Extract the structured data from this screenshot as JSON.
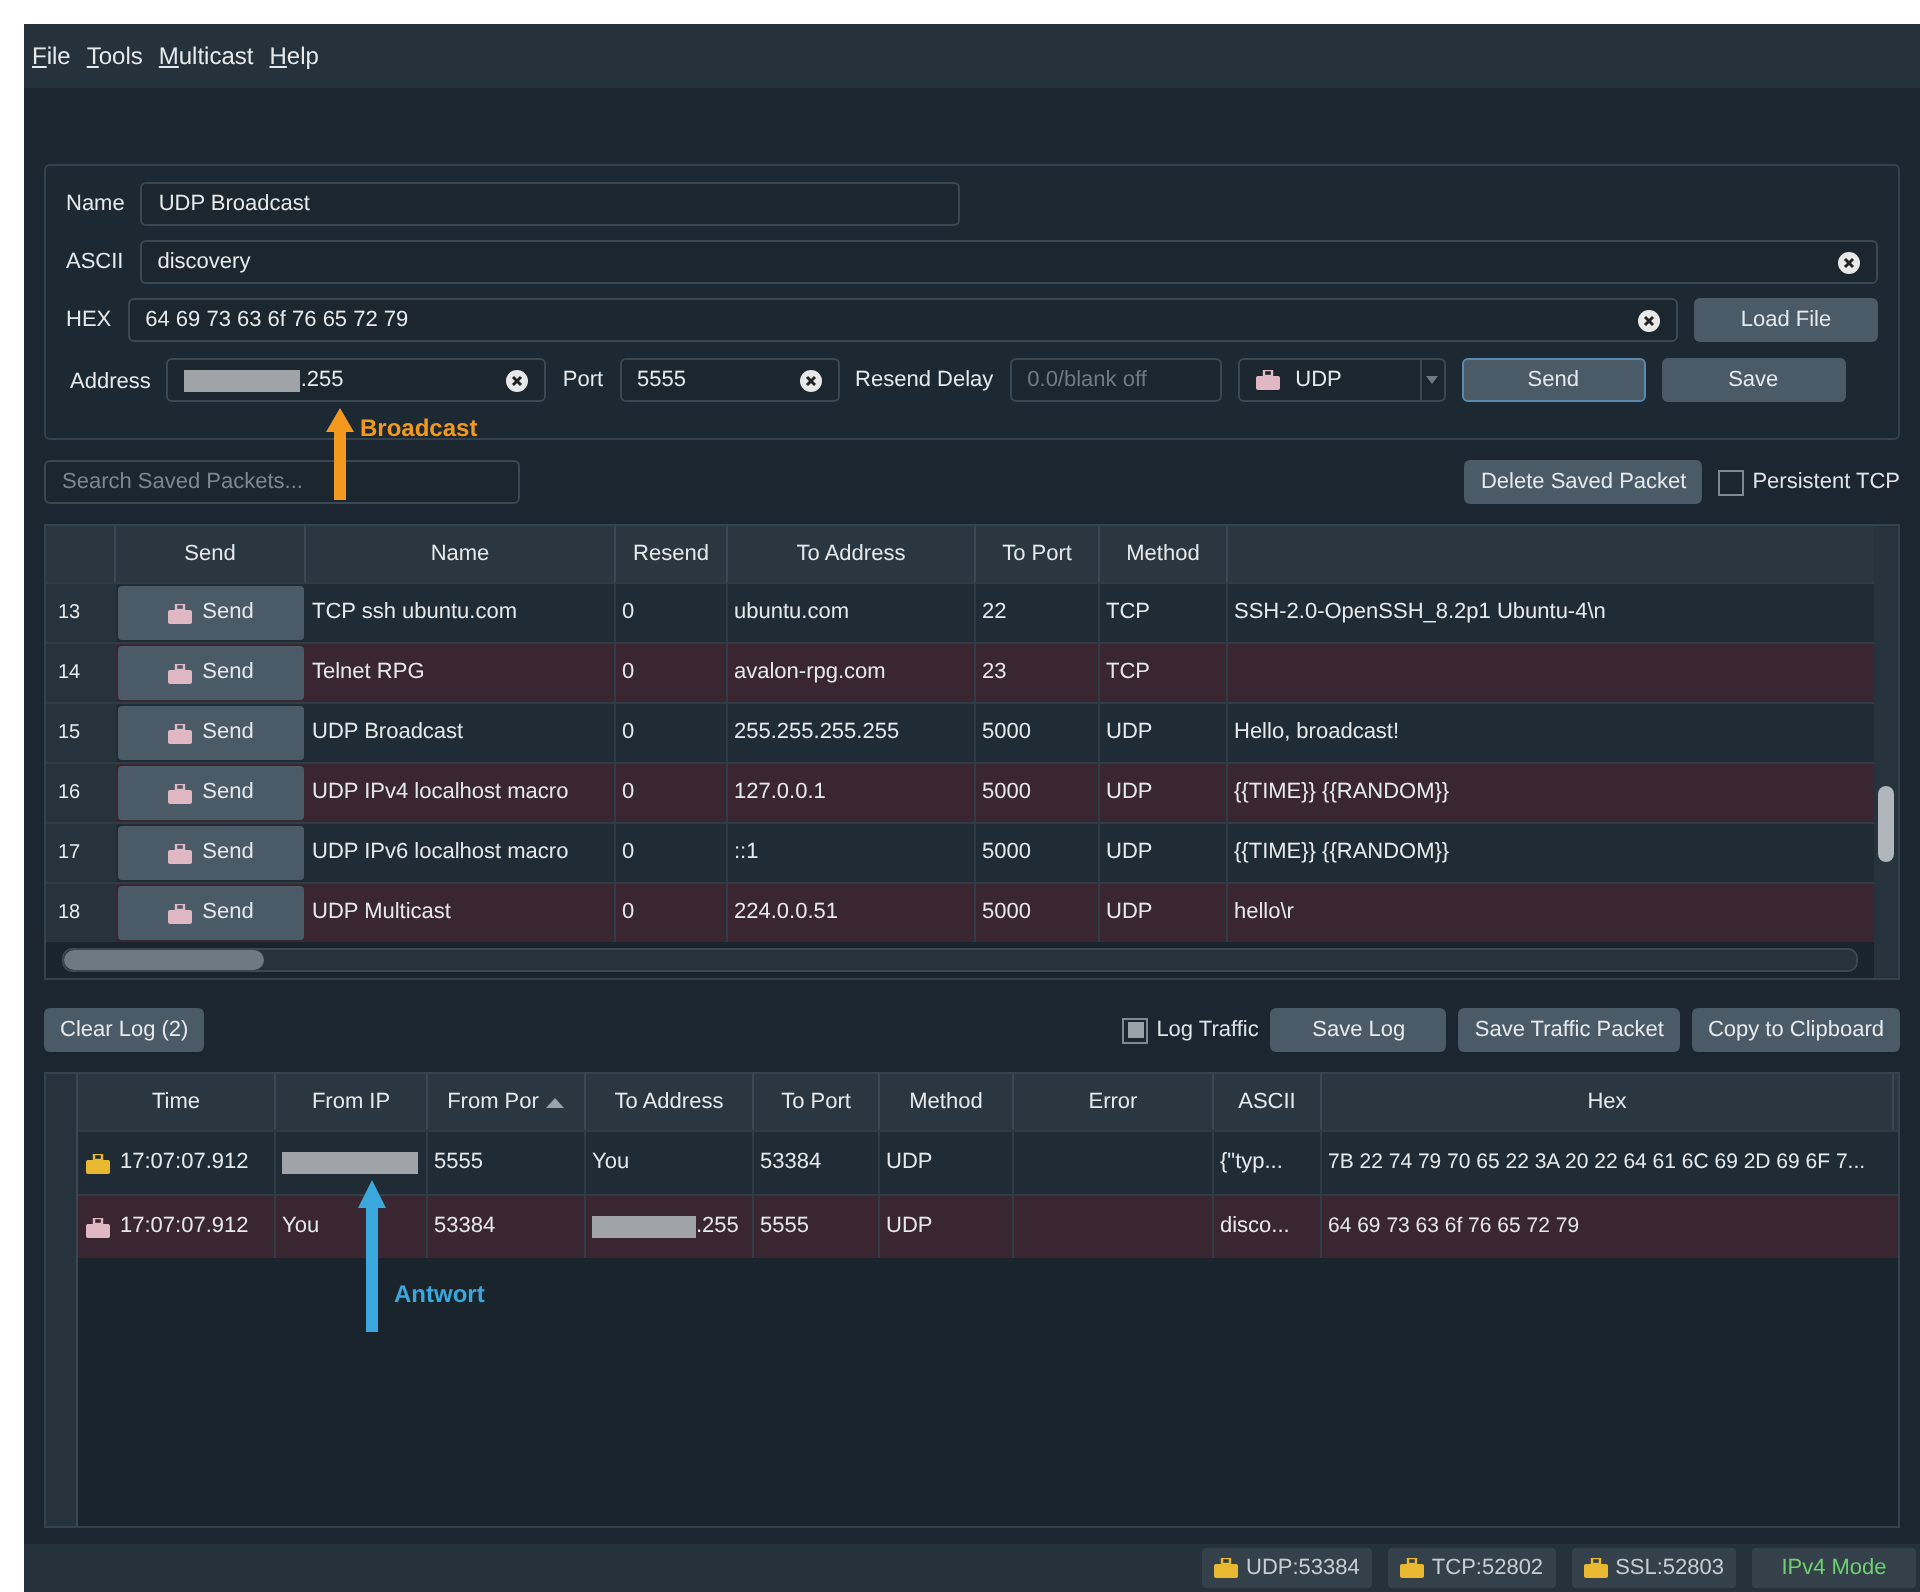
{
  "menu": [
    {
      "label": "File"
    },
    {
      "label": "Tools"
    },
    {
      "label": "Multicast"
    },
    {
      "label": "Help"
    }
  ],
  "form": {
    "name": {
      "label": "Name",
      "value": "UDP Broadcast"
    },
    "ascii": {
      "label": "ASCII",
      "value": "discovery"
    },
    "hex": {
      "label": "HEX",
      "value": "64 69 73 63 6f 76 65 72 79"
    },
    "address": {
      "label": "Address",
      "value": ".255",
      "redacted": true
    },
    "port": {
      "label": "Port",
      "value": "5555"
    },
    "resend_delay": {
      "label": "Resend Delay",
      "placeholder": "0.0/blank off"
    },
    "method": {
      "value": "UDP"
    },
    "load_file": "Load File",
    "send": "Send",
    "save": "Save"
  },
  "annotations": [
    {
      "text": "Broadcast",
      "color": "#f39a1e"
    },
    {
      "text": "Antwort",
      "color": "#3aa8dc"
    }
  ],
  "search": {
    "placeholder": "Search Saved Packets..."
  },
  "delete_button": "Delete Saved Packet",
  "persistent_tcp": {
    "label": "Persistent TCP",
    "checked": false
  },
  "packets": {
    "columns": [
      "Send",
      "Name",
      "Resend",
      "To Address",
      "To Port",
      "Method"
    ],
    "rows": [
      {
        "number": "13",
        "send": "Send",
        "name": "TCP ssh ubuntu.com",
        "resend": "0",
        "to_address": "ubuntu.com",
        "to_port": "22",
        "method": "TCP",
        "column_8": "SSH-2.0-OpenSSH_8.2p1 Ubuntu-4\\n"
      },
      {
        "number": "14",
        "send": "Send",
        "name": "Telnet RPG",
        "resend": "0",
        "to_address": "avalon-rpg.com",
        "to_port": "23",
        "method": "TCP"
      },
      {
        "number": "15",
        "send": "Send",
        "name": "UDP Broadcast",
        "resend": "0",
        "to_address": "255.255.255.255",
        "to_port": "5000",
        "method": "UDP",
        "column_8": "Hello, broadcast!"
      },
      {
        "number": "16",
        "send": "Send",
        "name": "UDP IPv4 localhost macro",
        "resend": "0",
        "to_address": "127.0.0.1",
        "to_port": "5000",
        "method": "UDP",
        "column_8": "{{TIME}} {{RANDOM}}"
      },
      {
        "number": "17",
        "send": "Send",
        "name": "UDP IPv6 localhost macro",
        "resend": "0",
        "to_address": "::1",
        "to_port": "5000",
        "method": "UDP",
        "column_8": "{{TIME}} {{RANDOM}}"
      },
      {
        "number": "18",
        "send": "Send",
        "name": "UDP Multicast",
        "resend": "0",
        "to_address": "224.0.0.51",
        "to_port": "5000",
        "method": "UDP",
        "column_8": "hello\\r"
      }
    ]
  },
  "log_toolbar": {
    "clear": "Clear Log (2)",
    "log_traffic": {
      "label": "Log Traffic",
      "checked": true
    },
    "buttons": [
      "Save Log",
      "Save Traffic Packet",
      "Copy to Clipboard"
    ]
  },
  "traffic": {
    "columns": [
      {
        "label": "Time",
        "sorted": false
      },
      {
        "label": "From IP",
        "sorted": false
      },
      {
        "label": "From Por",
        "sorted": true
      },
      {
        "label": "To Address",
        "sorted": false
      },
      {
        "label": "To Port",
        "sorted": false
      },
      {
        "label": "Method",
        "sorted": false
      },
      {
        "label": "Error",
        "sorted": false
      },
      {
        "label": "ASCII",
        "sorted": false
      },
      {
        "label": "Hex",
        "sorted": false
      }
    ],
    "rows": [
      {
        "kind": "received",
        "time": "17:07:07.912",
        "from_ip_redacted": true,
        "from_port": "5555",
        "to_address": "You",
        "to_address_redacted": false,
        "to_port": "53384",
        "method": "UDP",
        "ascii": "{\"typ...",
        "hex": "7B 22 74 79 70 65 22 3A 20 22 64 61 6C 69 2D 69 6F 7..."
      },
      {
        "kind": "sent",
        "time": "17:07:07.912",
        "from_ip": "You",
        "from_ip_redacted": false,
        "from_port": "53384",
        "to_address": ".255",
        "to_address_redacted": true,
        "to_port": "5555",
        "method": "UDP",
        "ascii": "disco...",
        "hex": "64 69 73 63 6f 76 65 72 79"
      }
    ]
  },
  "status_bar": [
    {
      "kind": "port",
      "text": "UDP:53384"
    },
    {
      "kind": "port",
      "text": "TCP:52802"
    },
    {
      "kind": "port",
      "text": "SSL:52803"
    },
    {
      "kind": "mode",
      "text": "IPv4 Mode"
    }
  ]
}
